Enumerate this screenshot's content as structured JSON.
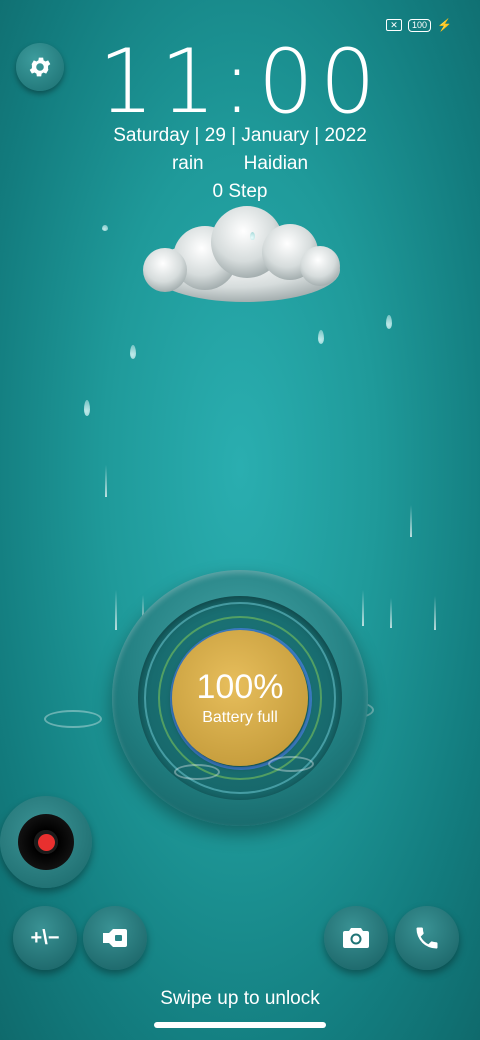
{
  "status_bar": {
    "sim_icon": "no-sim-icon",
    "battery_level": "100",
    "charging_icon": "bolt-icon"
  },
  "clock": {
    "time": "11:00"
  },
  "date": {
    "text": "Saturday | 29 | January | 2022"
  },
  "weather": {
    "condition": "rain",
    "location": "Haidian",
    "steps": "0 Step",
    "icon": "cloud-icon"
  },
  "battery": {
    "percent": "100%",
    "status": "Battery full",
    "fill_fraction": 1.0,
    "core_color": "#d1a845"
  },
  "shortcuts": {
    "settings": "gear-icon",
    "recorder": "vinyl-record-icon",
    "calculator_label": "+\\−",
    "flashlight": "flashlight-icon",
    "camera": "camera-icon",
    "phone": "phone-icon"
  },
  "unlock": {
    "hint": "Swipe up to unlock"
  },
  "colors": {
    "background": "#1f9a9a",
    "accent_red": "#e8302f"
  }
}
